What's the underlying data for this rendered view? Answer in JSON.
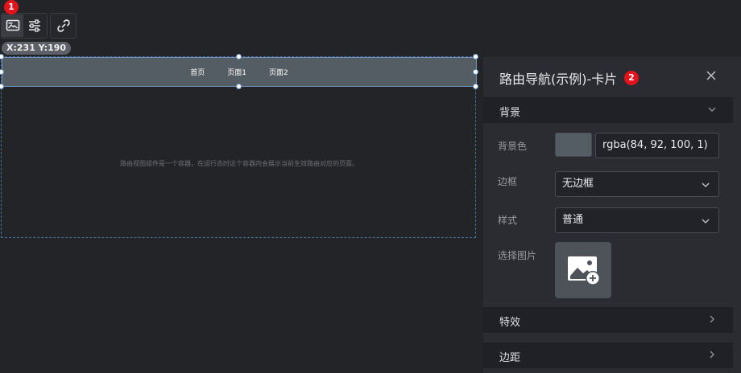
{
  "toolbar": {
    "badge_1": "1",
    "coords": "X:231 Y:190"
  },
  "canvas": {
    "nav_items": [
      "首页",
      "页面1",
      "页面2"
    ],
    "hint": "路由视图组件是一个容器，在运行态时这个容器内会展示当前生效路由对应的页面。"
  },
  "panel": {
    "title": "路由导航(示例)-卡片",
    "badge_2": "2",
    "sections": {
      "background": "背景",
      "effects": "特效",
      "margin": "边距"
    },
    "rows": {
      "bg_color_label": "背景色",
      "bg_color_value": "rgba(84, 92, 100, 1)",
      "border_label": "边框",
      "border_value": "无边框",
      "style_label": "样式",
      "style_value": "普通",
      "image_label": "选择图片"
    }
  },
  "colors": {
    "nav_background": "#545c64",
    "badge": "#e3121b",
    "selection": "#6f92c0"
  }
}
